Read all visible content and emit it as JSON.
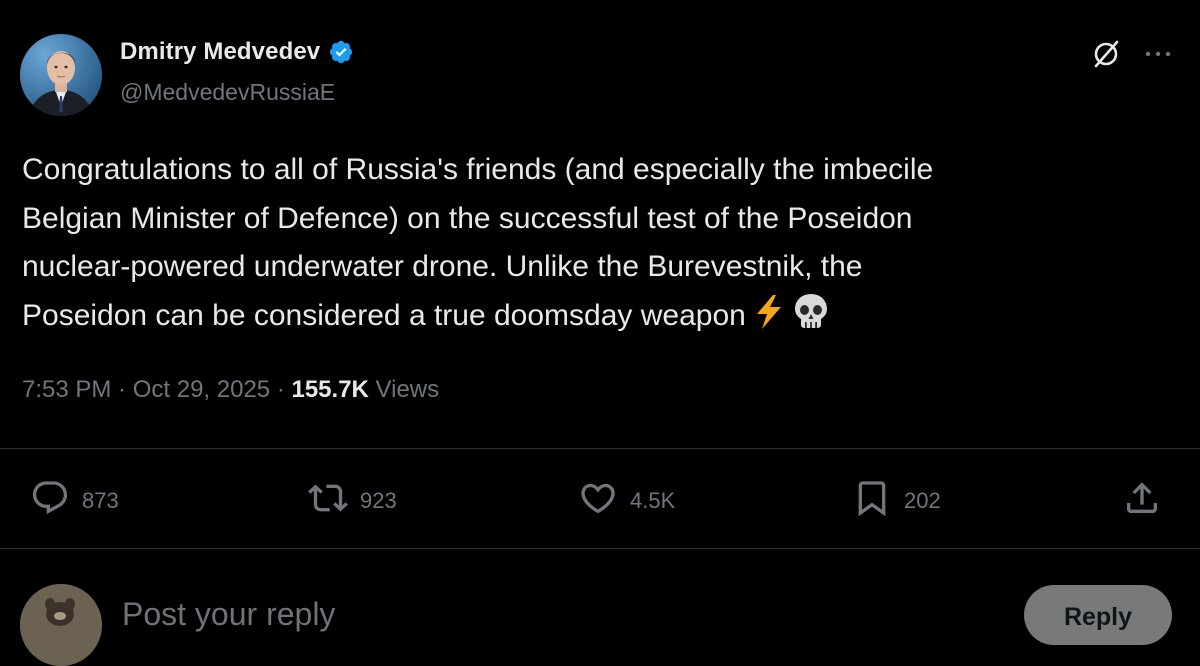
{
  "author": {
    "display_name": "Dmitry Medvedev",
    "handle": "@MedvedevRussiaE",
    "verified": true,
    "verified_color": "#1d9bf0",
    "avatar": "profile-photo"
  },
  "header_icons": [
    "grok-icon",
    "more-icon"
  ],
  "tweet": {
    "text": "Congratulations to all of Russia's friends (and especially the imbecile\nBelgian Minister of Defence) on the successful test of the Poseidon\nnuclear-powered underwater drone. Unlike the Burevestnik, the\nPoseidon can be considered a true doomsday weapon",
    "emojis": [
      "⚡",
      "💀"
    ]
  },
  "meta": {
    "time": "7:53 PM",
    "date": "Oct 29, 2025",
    "separator": " · ",
    "views_count": "155.7K",
    "views_label": "Views"
  },
  "actions": {
    "replies": "873",
    "reposts": "923",
    "likes": "4.5K",
    "bookmarks": "202"
  },
  "composer": {
    "placeholder": "Post your reply",
    "button_label": "Reply"
  },
  "colors": {
    "background": "#000000",
    "text": "#e7e9ea",
    "muted": "#71767b",
    "divider": "#2f3336",
    "reply_button": "#787a7a"
  }
}
